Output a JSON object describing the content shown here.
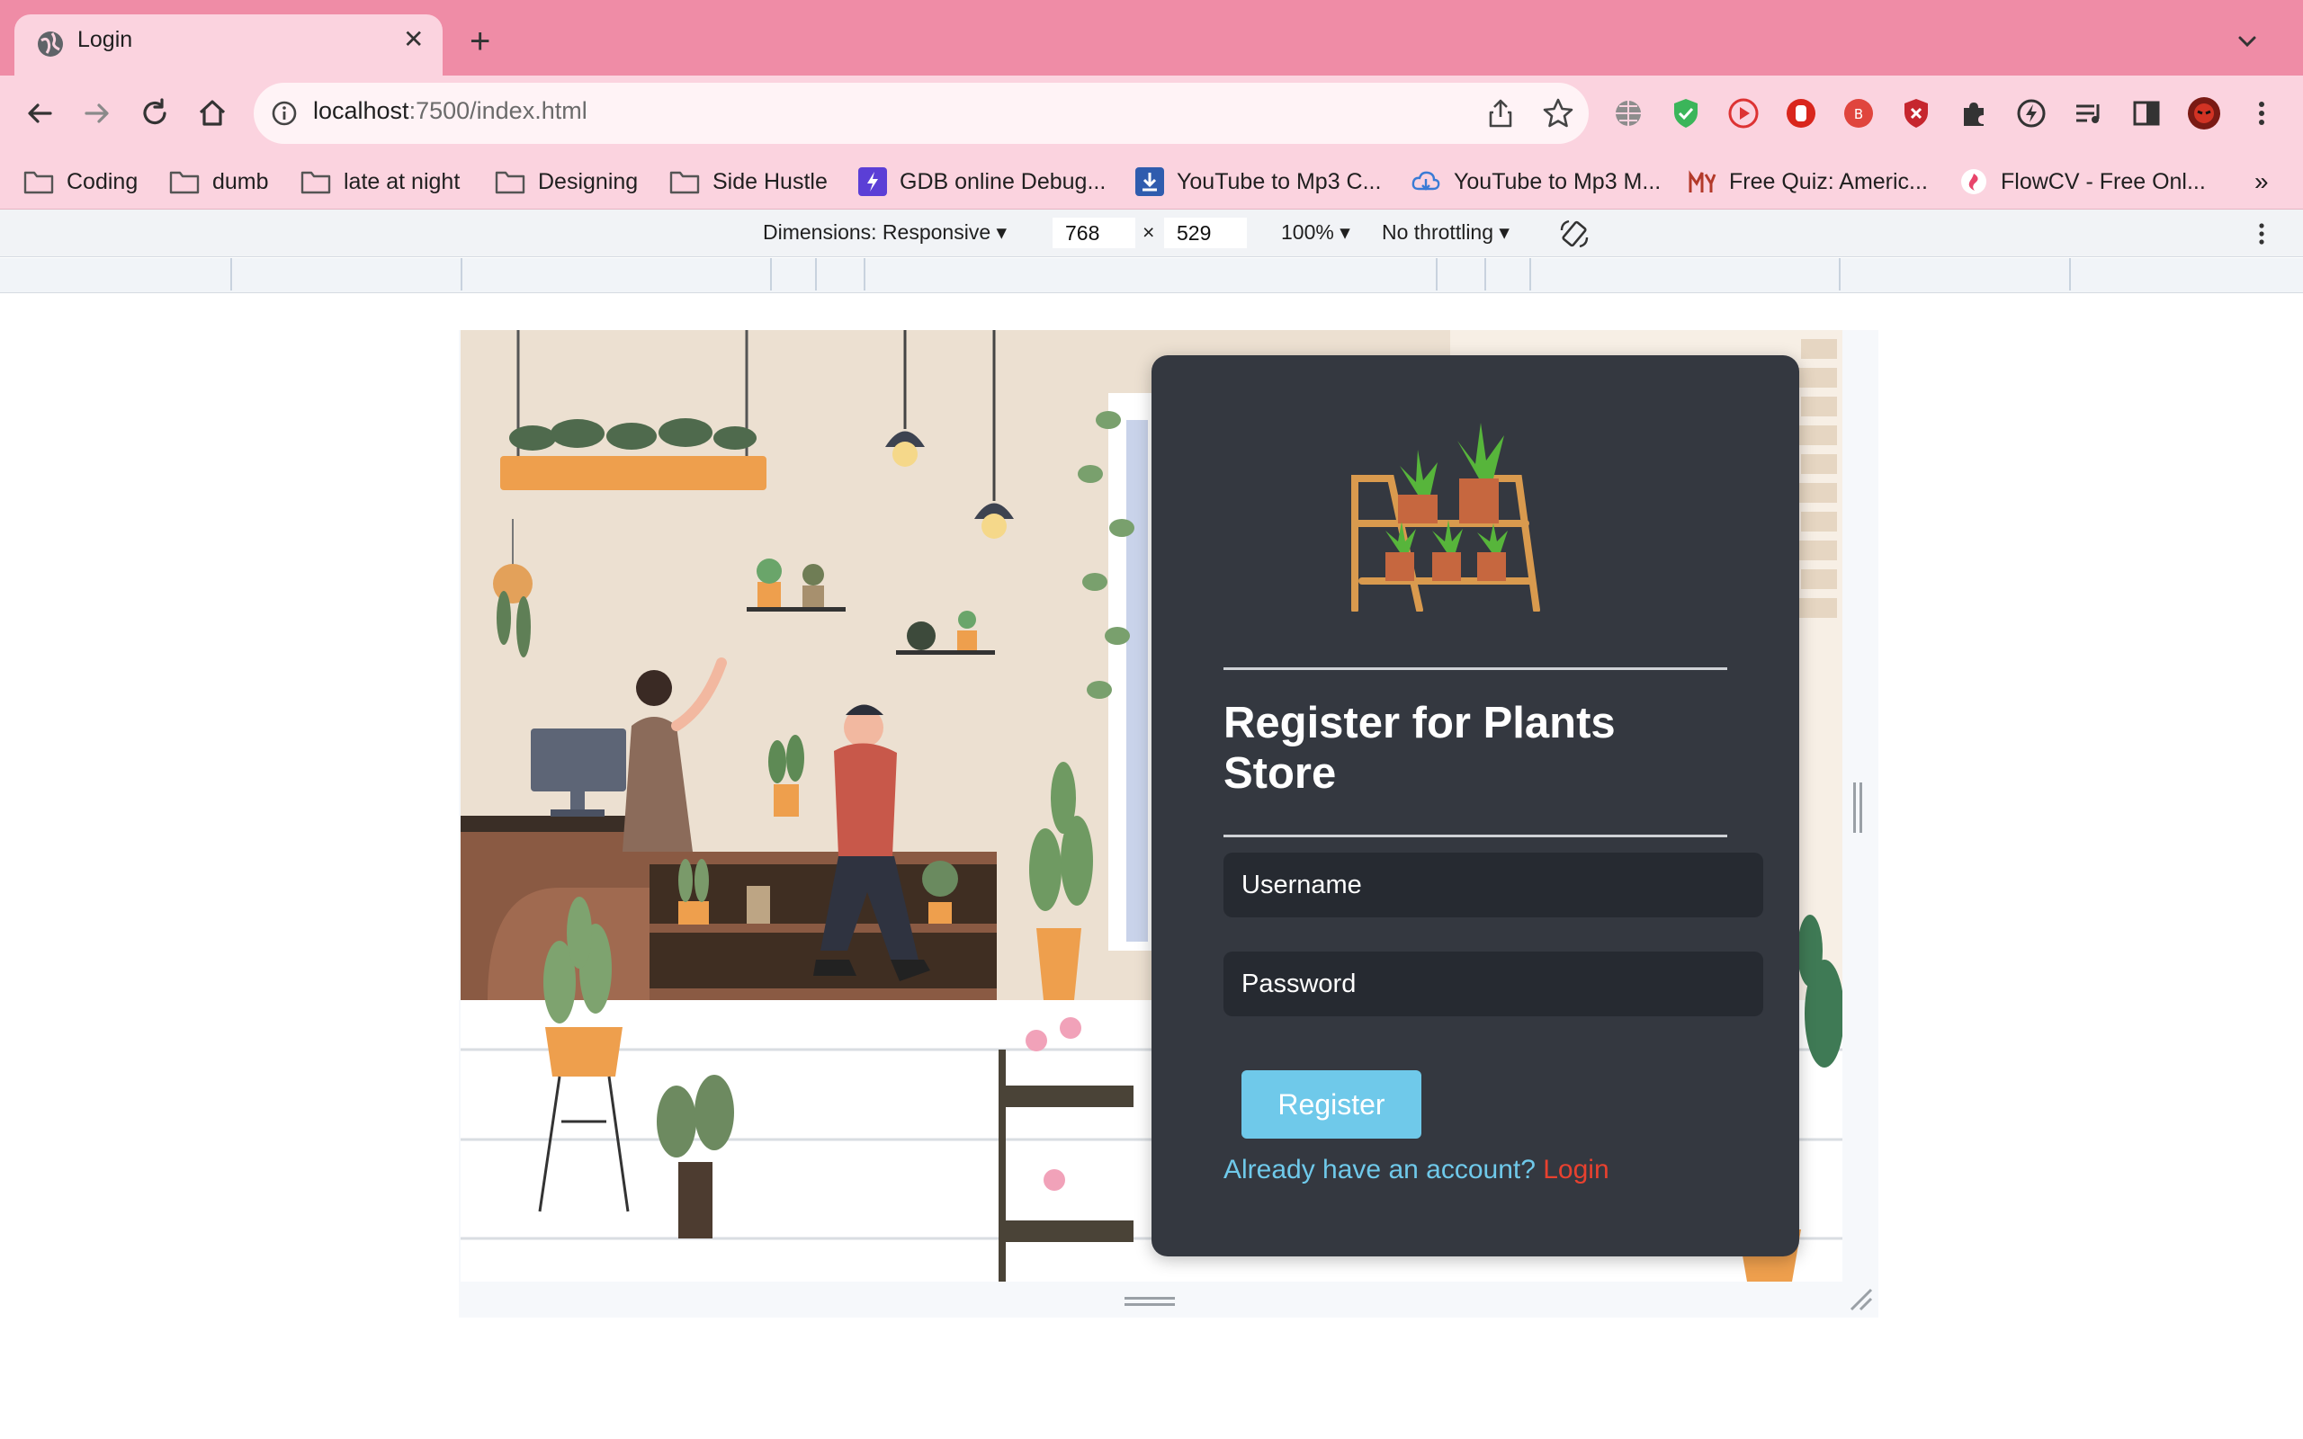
{
  "browser": {
    "tab_title": "Login",
    "tab_close": "✕",
    "new_tab": "+",
    "url_host": "localhost",
    "url_rest": ":7500/index.html"
  },
  "bookmarks": [
    {
      "label": "Coding",
      "icon": "folder-icon"
    },
    {
      "label": "dumb",
      "icon": "folder-icon"
    },
    {
      "label": "late at night",
      "icon": "folder-icon"
    },
    {
      "label": "Designing",
      "icon": "folder-icon"
    },
    {
      "label": "Side Hustle",
      "icon": "folder-icon"
    },
    {
      "label": "GDB online Debug...",
      "icon": "gdb-icon"
    },
    {
      "label": "YouTube to Mp3 C...",
      "icon": "download-icon"
    },
    {
      "label": "YouTube to Mp3 M...",
      "icon": "cloud-download-icon"
    },
    {
      "label": "Free Quiz: Americ...",
      "icon": "quiz-icon"
    },
    {
      "label": "FlowCV - Free Onl...",
      "icon": "flowcv-icon"
    }
  ],
  "bookmarks_overflow": "»",
  "devtools": {
    "dimensions_label": "Dimensions: Responsive",
    "width": "768",
    "times": "×",
    "height": "529",
    "zoom": "100%",
    "throttling": "No throttling"
  },
  "register": {
    "title": "Register for Plants Store",
    "username_placeholder": "Username",
    "password_placeholder": "Password",
    "register_button": "Register",
    "prompt": "Already have an account?",
    "login_link": "Login"
  },
  "colors": {
    "tabstrip": "#ef8ca6",
    "toolbar": "#fbd3df",
    "card": "#343840",
    "field": "#262a31",
    "accent": "#6fc9ea",
    "link": "#e8412f"
  }
}
